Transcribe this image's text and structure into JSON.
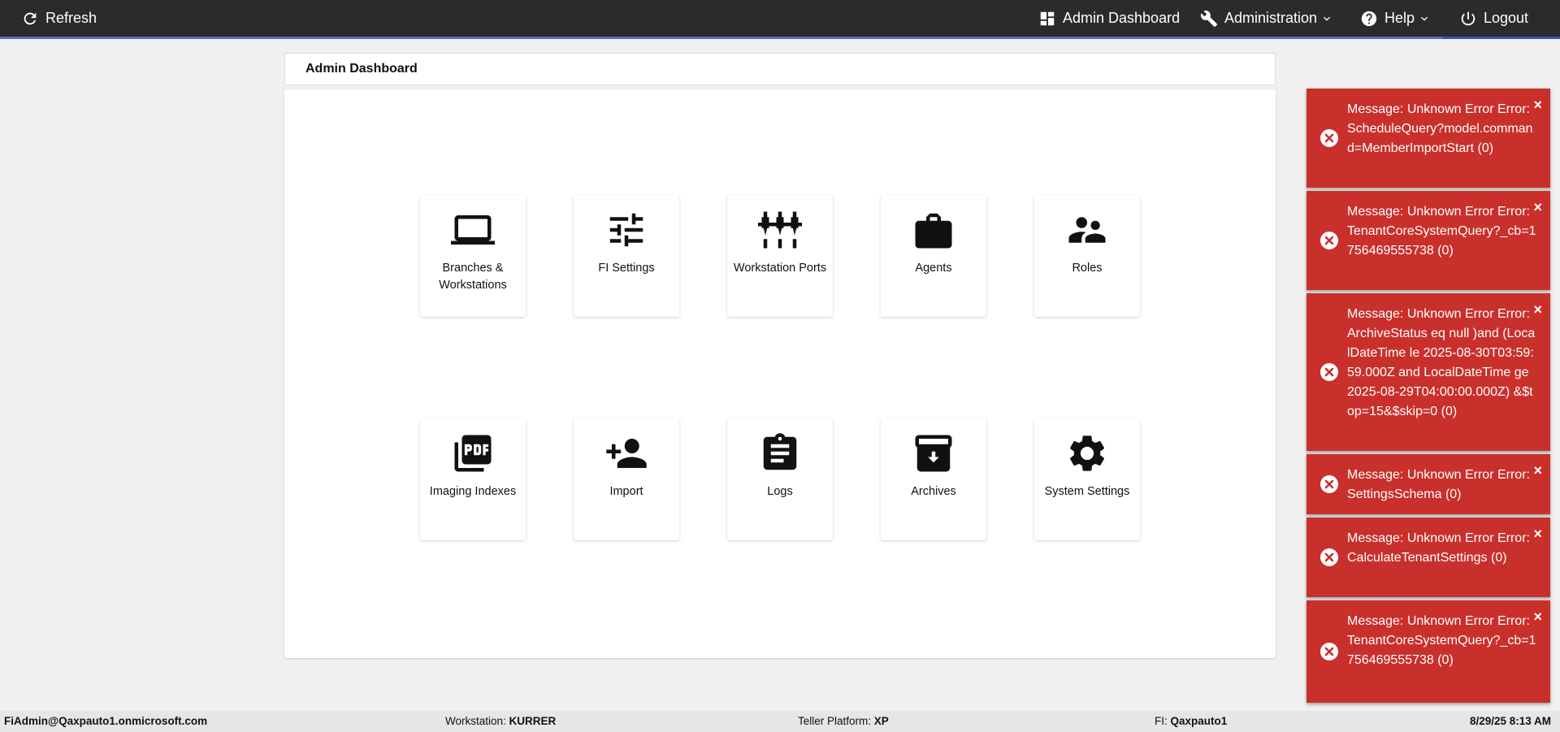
{
  "navbar": {
    "refresh_label": "Refresh",
    "admin_dashboard_label": "Admin Dashboard",
    "administration_label": "Administration",
    "help_label": "Help",
    "logout_label": "Logout"
  },
  "page": {
    "title": "Admin Dashboard"
  },
  "tiles": [
    {
      "label": "Branches & Workstations",
      "icon": "laptop-icon"
    },
    {
      "label": "FI Settings",
      "icon": "sliders-icon"
    },
    {
      "label": "Workstation Ports",
      "icon": "ports-icon"
    },
    {
      "label": "Agents",
      "icon": "briefcase-icon"
    },
    {
      "label": "Roles",
      "icon": "people-icon"
    },
    {
      "label": "Imaging Indexes",
      "icon": "pdf-icon"
    },
    {
      "label": "Import",
      "icon": "add-person-icon"
    },
    {
      "label": "Logs",
      "icon": "clipboard-icon"
    },
    {
      "label": "Archives",
      "icon": "archive-icon"
    },
    {
      "label": "System Settings",
      "icon": "gear-icon"
    }
  ],
  "toasts": [
    {
      "message": "Message: Unknown Error Error: ScheduleQuery?model.command=MemberImportStart (0)"
    },
    {
      "message": "Message: Unknown Error Error: TenantCoreSystemQuery?_cb=1756469555738 (0)"
    },
    {
      "message": "Message: Unknown Error Error: ArchiveStatus eq null )and (LocalDateTime le 2025-08-30T03:59:59.000Z and LocalDateTime ge 2025-08-29T04:00:00.000Z) &$top=15&$skip=0 (0)"
    },
    {
      "message": "Message: Unknown Error Error: SettingsSchema (0)"
    },
    {
      "message": "Message: Unknown Error Error: CalculateTenantSettings (0)"
    },
    {
      "message": "Message: Unknown Error Error: TenantCoreSystemQuery?_cb=1756469555738 (0)"
    }
  ],
  "toast_close_label": "×",
  "footer": {
    "user": "FiAdmin@Qaxpauto1.onmicrosoft.com",
    "workstation_label": "Workstation:",
    "workstation_value": "KURRER",
    "teller_label": "Teller Platform:",
    "teller_value": "XP",
    "fi_label": "FI:",
    "fi_value": "Qaxpauto1",
    "datetime": "8/29/25 8:13 AM"
  },
  "colors": {
    "navbar": "#2b2b2b",
    "accent": "#3f51b5",
    "toast": "#c9302c"
  }
}
